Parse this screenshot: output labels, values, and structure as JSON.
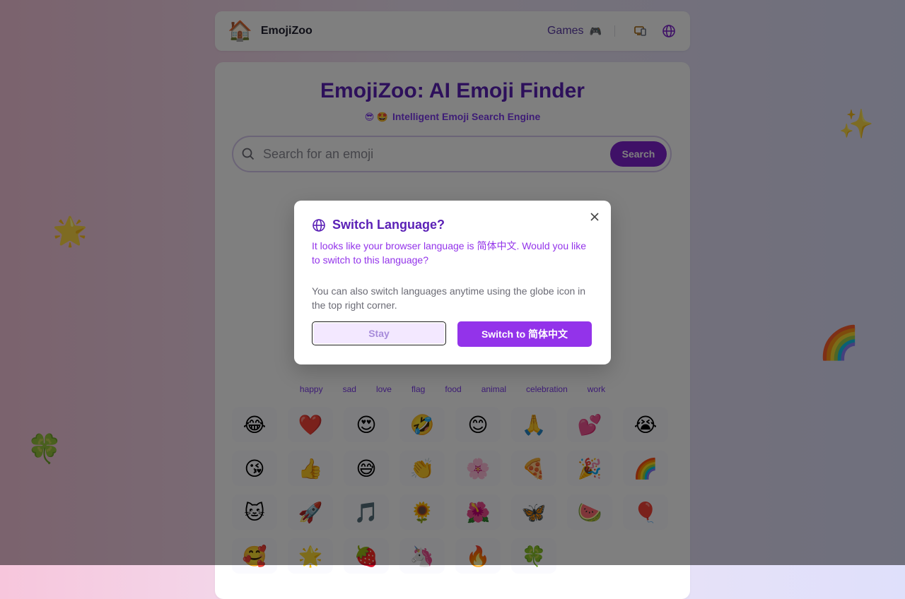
{
  "colors": {
    "accent": "#7e22ce",
    "title": "#5b21b6",
    "desc": "#9333ea"
  },
  "decorations": [
    "✨",
    "🌟",
    "🌈",
    "🍀"
  ],
  "navbar": {
    "logo_emoji": "🏠",
    "brand": "EmojiZoo",
    "games_label": "Games",
    "games_emoji": "🎮",
    "icons": [
      "devices-icon",
      "globe-icon"
    ]
  },
  "hero": {
    "title": "EmojiZoo: AI Emoji Finder",
    "subtitle_emojis": "😎 🤩",
    "subtitle": "Intelligent Emoji Search Engine"
  },
  "search": {
    "placeholder": "Search for an emoji",
    "button_label": "Search"
  },
  "tags": [
    "happy",
    "sad",
    "love",
    "flag",
    "food",
    "animal",
    "celebration",
    "work"
  ],
  "emoji_grid": [
    "😂",
    "❤️",
    "😍",
    "🤣",
    "😊",
    "🙏",
    "💕",
    "😭",
    "😘",
    "👍",
    "😅",
    "👏",
    "🌸",
    "🍕",
    "🎉",
    "🌈",
    "🐱",
    "🚀",
    "🎵",
    "🌻",
    "🌺",
    "🦋",
    "🍉",
    "🎈",
    "🥰",
    "🌟",
    "🍓",
    "🦄",
    "🔥",
    "🍀",
    "",
    ""
  ],
  "modal": {
    "title": "Switch Language?",
    "description": "It looks like your browser language is 简体中文. Would you like to switch to this language?",
    "hint": "You can also switch languages anytime using the globe icon in the top right corner.",
    "stay_label": "Stay",
    "switch_label": "Switch to 简体中文"
  }
}
